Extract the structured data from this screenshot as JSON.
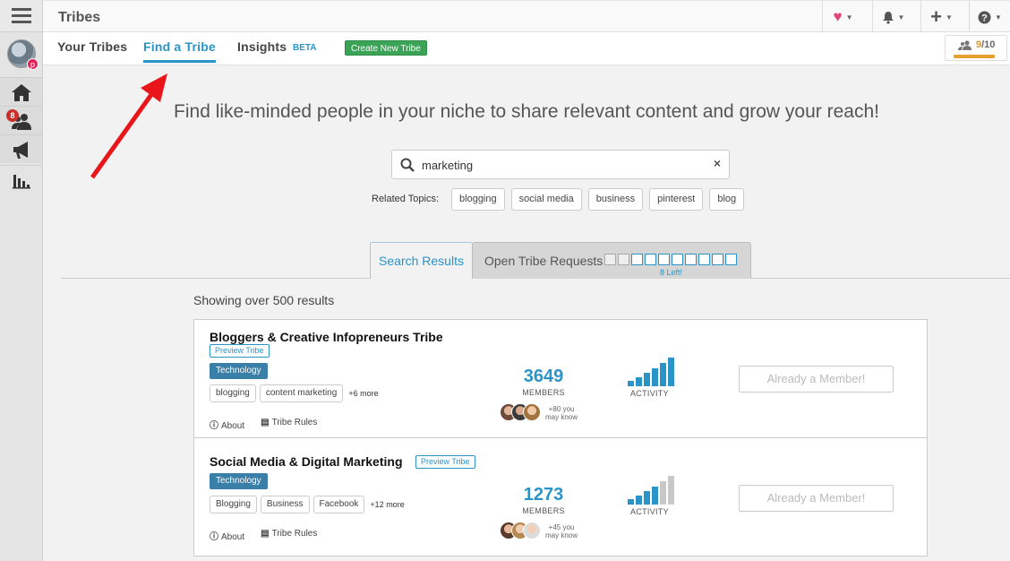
{
  "app": {
    "title": "Tribes"
  },
  "rail": {
    "notification_badge": "8"
  },
  "topbar": {
    "heart_icon": "heart-icon",
    "bell_icon": "bell-icon",
    "plus_icon": "plus-icon",
    "help_icon": "question-circle-icon"
  },
  "subnav": {
    "tabs": [
      {
        "label": "Your Tribes"
      },
      {
        "label": "Find a Tribe",
        "active": true
      },
      {
        "label": "Insights"
      }
    ],
    "beta": "BETA",
    "create_button": "Create New Tribe",
    "quota": {
      "used": "9",
      "total": "/10",
      "fill_fraction": 0.9
    }
  },
  "main": {
    "headline": "Find like-minded people in your niche to share relevant content and grow your reach!",
    "search": {
      "value": "marketing",
      "clear": "×"
    },
    "related_label": "Related Topics:",
    "related_topics": [
      "blogging",
      "social media",
      "business",
      "pinterest",
      "blog"
    ],
    "tabs": {
      "results": "Search Results",
      "requests": "Open Tribe Requests",
      "left": "8 Left!",
      "used_slots": 2,
      "total_slots": 10
    },
    "showing": "Showing over 500 results"
  },
  "tribes": [
    {
      "name": "Bloggers & Creative Infopreneurs Tribe",
      "preview": "Preview Tribe",
      "category": "Technology",
      "tags": [
        "blogging",
        "content marketing"
      ],
      "more": "+6 more",
      "about": "About",
      "rules": "Tribe Rules",
      "members": "3649",
      "members_label": "MEMBERS",
      "you_know": [
        "+80 you",
        "may know"
      ],
      "activity_label": "ACTIVITY",
      "activity_level": 6,
      "member_button": "Already a Member!"
    },
    {
      "name": "Social Media & Digital Marketing",
      "preview": "Preview Tribe",
      "category": "Technology",
      "tags": [
        "Blogging",
        "Business",
        "Facebook"
      ],
      "more": "+12 more",
      "about": "About",
      "rules": "Tribe Rules",
      "members": "1273",
      "members_label": "MEMBERS",
      "you_know": [
        "+45 you",
        "may know"
      ],
      "activity_label": "ACTIVITY",
      "activity_level": 4,
      "member_button": "Already a Member!"
    }
  ],
  "colors": {
    "accent": "#2a94c9",
    "create": "#3aa356",
    "category": "#3a7fa8",
    "annotation_arrow": "#e8161b"
  }
}
